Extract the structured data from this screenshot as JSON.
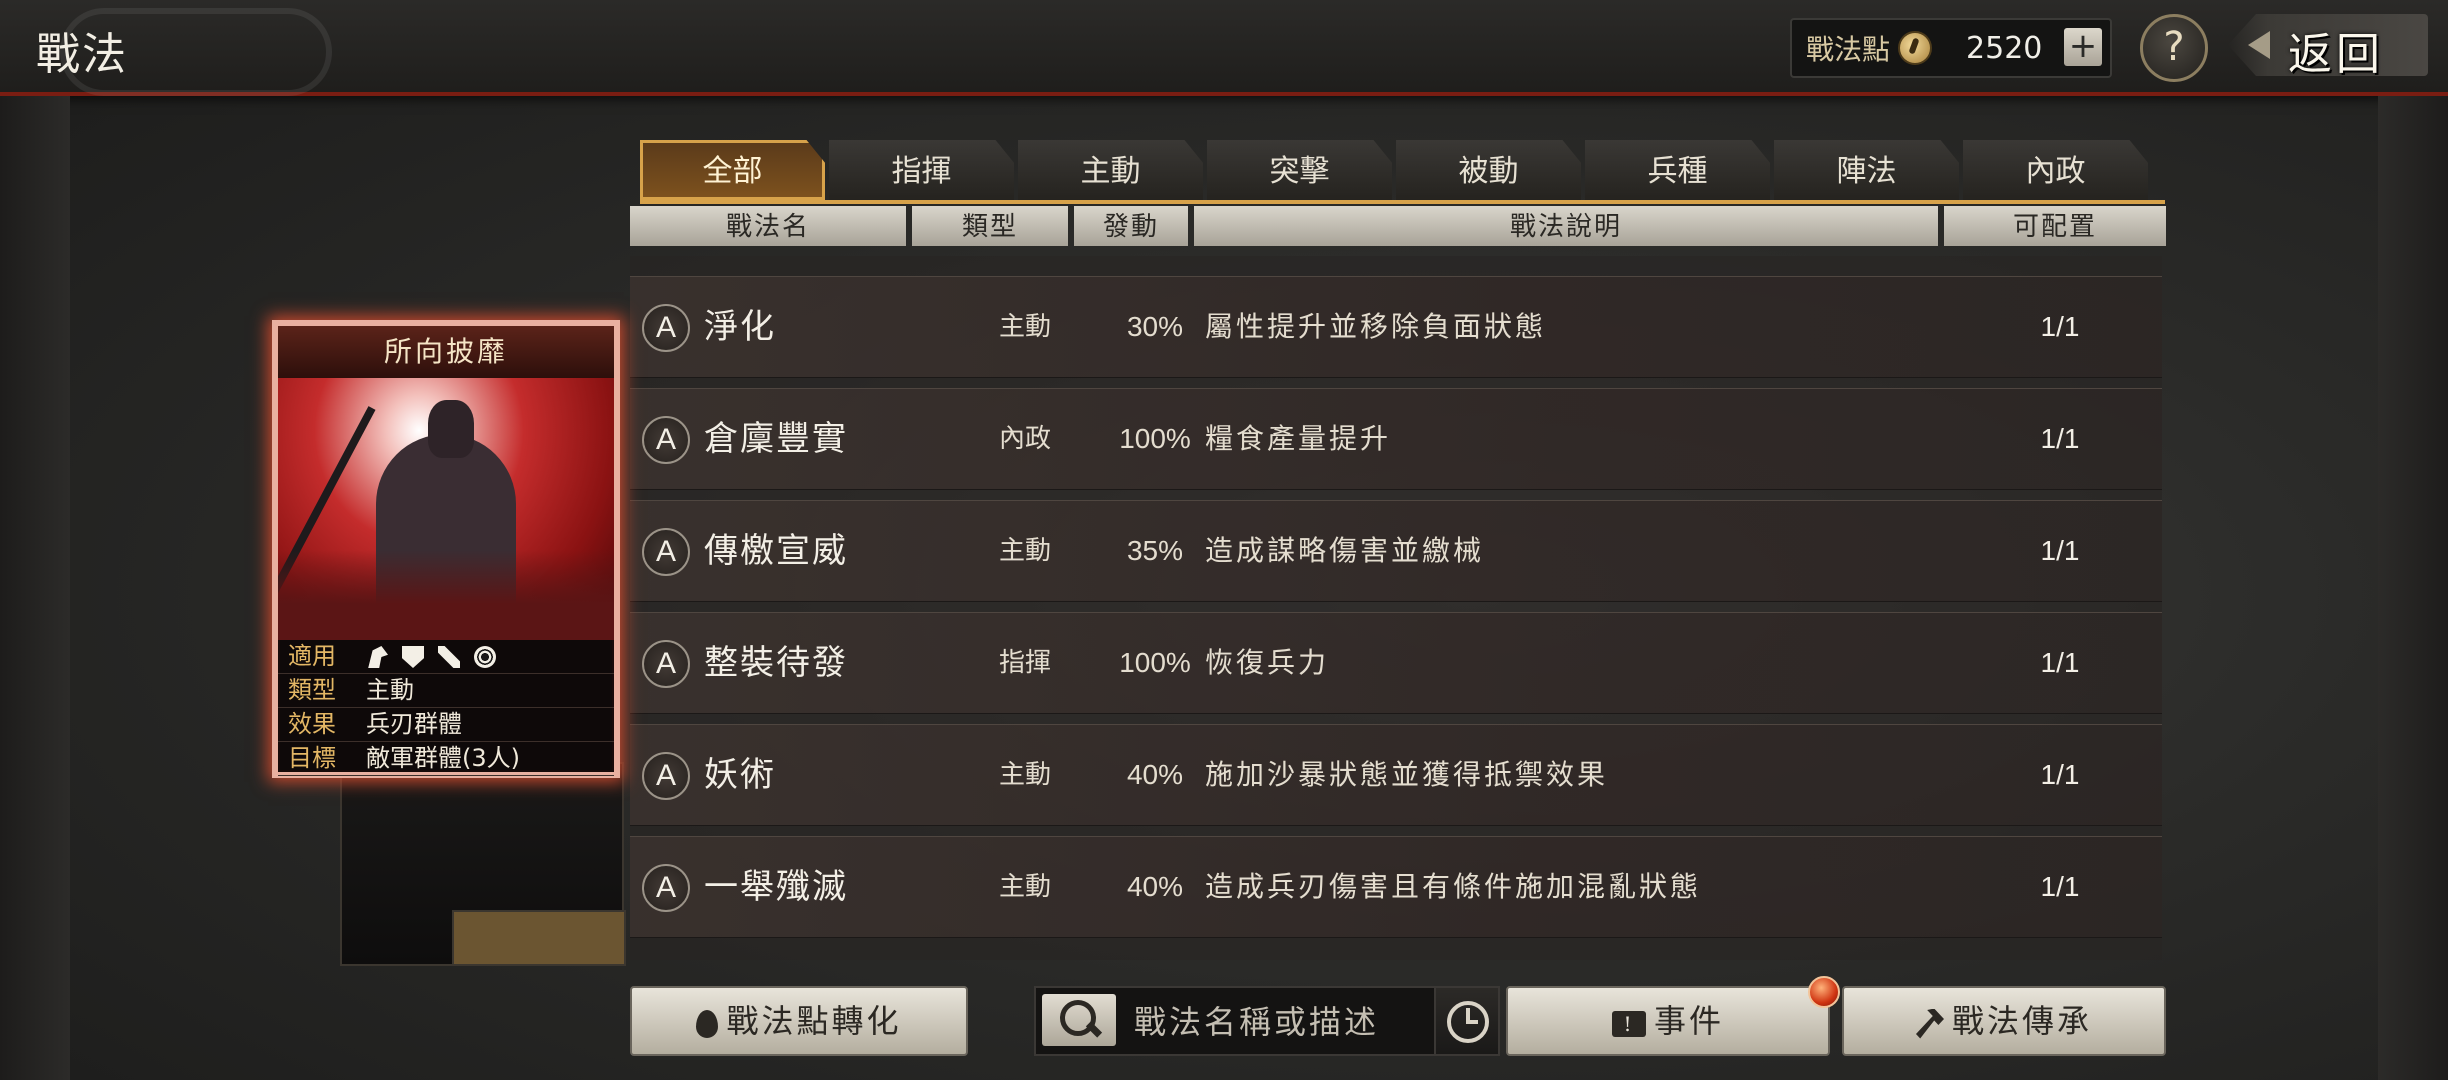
{
  "header": {
    "title": "戰法",
    "points_label": "戰法點",
    "points_value": "2520",
    "plus_label": "+",
    "help_label": "?",
    "back_label": "返回"
  },
  "tabs": [
    {
      "label": "全部",
      "active": true
    },
    {
      "label": "指揮"
    },
    {
      "label": "主動"
    },
    {
      "label": "突擊"
    },
    {
      "label": "被動"
    },
    {
      "label": "兵種"
    },
    {
      "label": "陣法"
    },
    {
      "label": "內政"
    }
  ],
  "columns": {
    "name": "戰法名",
    "type": "類型",
    "rate": "發動",
    "desc": "戰法說明",
    "slot": "可配置"
  },
  "rows": [
    {
      "grade": "A",
      "name": "淨化",
      "type": "主動",
      "rate": "30%",
      "desc": "屬性提升並移除負面狀態",
      "slot": "1/1"
    },
    {
      "grade": "A",
      "name": "倉廩豐實",
      "type": "內政",
      "rate": "100%",
      "desc": "糧食產量提升",
      "slot": "1/1"
    },
    {
      "grade": "A",
      "name": "傳檄宣威",
      "type": "主動",
      "rate": "35%",
      "desc": "造成謀略傷害並繳械",
      "slot": "1/1"
    },
    {
      "grade": "A",
      "name": "整裝待發",
      "type": "指揮",
      "rate": "100%",
      "desc": "恢復兵力",
      "slot": "1/1"
    },
    {
      "grade": "A",
      "name": "妖術",
      "type": "主動",
      "rate": "40%",
      "desc": "施加沙暴狀態並獲得抵禦效果",
      "slot": "1/1"
    },
    {
      "grade": "A",
      "name": "一舉殲滅",
      "type": "主動",
      "rate": "40%",
      "desc": "造成兵刃傷害且有條件施加混亂狀態",
      "slot": "1/1"
    }
  ],
  "card": {
    "title": "所向披靡",
    "applies_key": "適用",
    "unit_icons": [
      "cavalry-icon",
      "shield-icon",
      "archer-icon",
      "siege-icon"
    ],
    "type_key": "類型",
    "type_val": "主動",
    "effect_key": "效果",
    "effect_val": "兵刃群體",
    "target_key": "目標",
    "target_val": "敵軍群體(3人)"
  },
  "footer": {
    "convert_label": "戰法點轉化",
    "search_placeholder": "戰法名稱或描述",
    "event_label": "事件",
    "event_icon_text": "!",
    "inherit_label": "戰法傳承"
  },
  "colors": {
    "accent": "#d7a24a",
    "header_border": "#7a1d12",
    "card_glow": "#c7492e"
  }
}
